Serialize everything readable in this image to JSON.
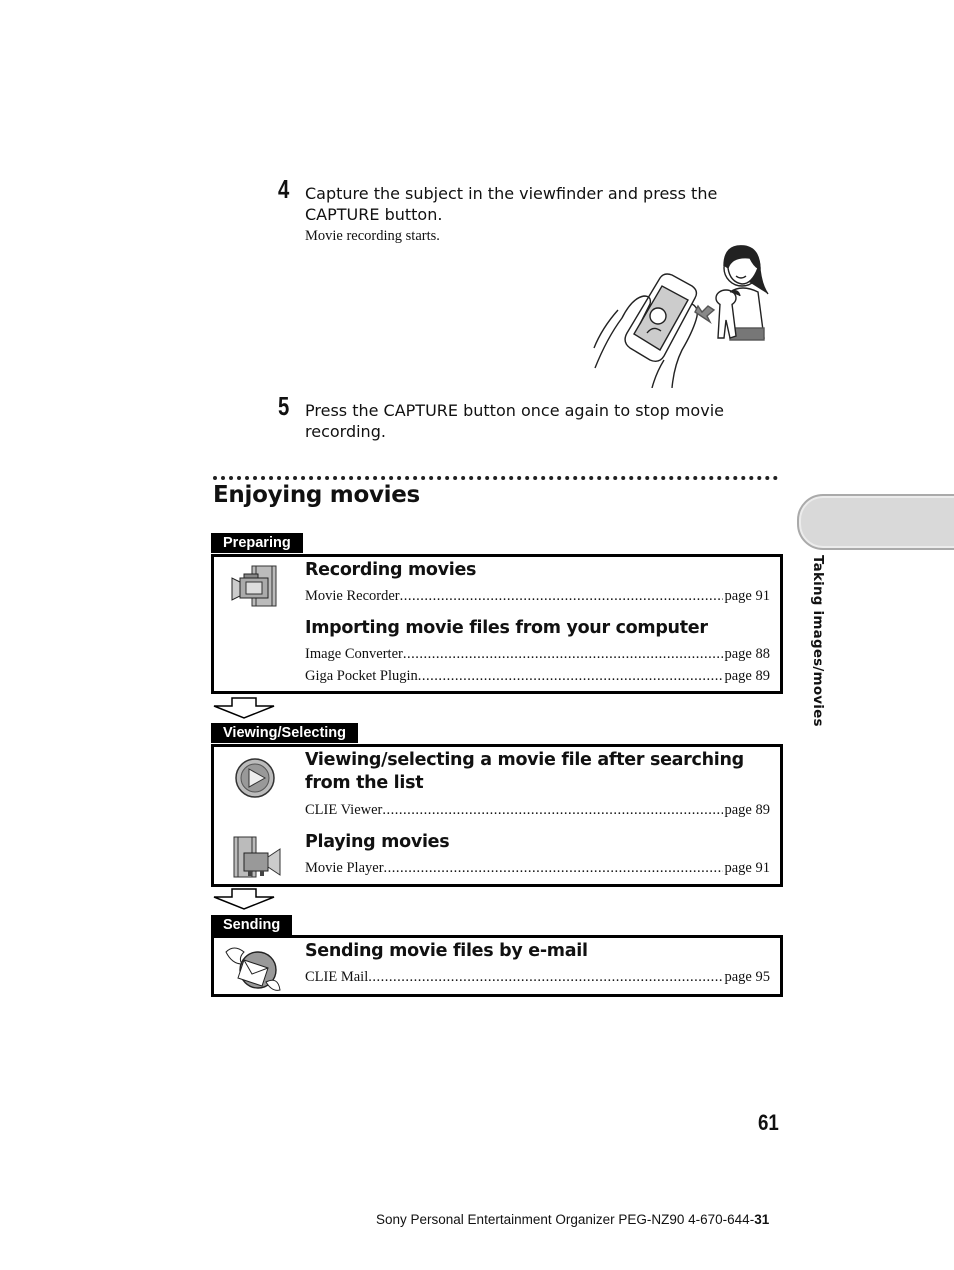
{
  "steps": [
    {
      "number": "4",
      "text_line1": "Capture the subject in the viewfinder and press the",
      "text_line2": "CAPTURE button.",
      "note": "Movie recording starts."
    },
    {
      "number": "5",
      "text_line1": "Press the CAPTURE button once again to stop movie",
      "text_line2": "recording."
    }
  ],
  "illustration": {
    "description": "hands-holding-device-capturing-girl-with-dog"
  },
  "section_title": "Enjoying movies",
  "groups": [
    {
      "tab": "Preparing",
      "sections": [
        {
          "icon": "movie-recorder-icon",
          "title": "Recording movies",
          "entries": [
            {
              "name": "Movie Recorder",
              "page": "page 91"
            }
          ]
        },
        {
          "icon": "",
          "title": "Importing movie files from your computer",
          "entries": [
            {
              "name": "Image Converter",
              "page": "page 88"
            },
            {
              "name": "Giga Pocket Plugin ",
              "page": "page 89"
            }
          ]
        }
      ]
    },
    {
      "tab": "Viewing/Selecting",
      "sections": [
        {
          "icon": "clie-viewer-icon",
          "title_line1": "Viewing/selecting a movie file after searching",
          "title_line2": "from the list",
          "entries": [
            {
              "name": "CLIE Viewer ",
              "page": "page 89"
            }
          ]
        },
        {
          "icon": "movie-player-icon",
          "title": "Playing movies",
          "entries": [
            {
              "name": "Movie Player ",
              "page": "page 91"
            }
          ]
        }
      ]
    },
    {
      "tab": "Sending",
      "sections": [
        {
          "icon": "clie-mail-icon",
          "title": "Sending movie files by e-mail",
          "entries": [
            {
              "name": "CLIE Mail ",
              "page": "page 95"
            }
          ]
        }
      ]
    }
  ],
  "side_tab": {
    "label": "Taking images/movies"
  },
  "page_number": "61",
  "footer": {
    "text": "Sony Personal Entertainment Organizer  PEG-NZ90  4-670-644-",
    "bold": "31"
  }
}
